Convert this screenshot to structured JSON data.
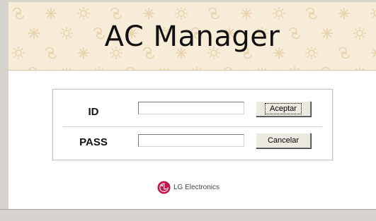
{
  "app": {
    "title": "AC Manager"
  },
  "login": {
    "id_label": "ID",
    "id_value": "",
    "pass_label": "PASS",
    "pass_value": "",
    "accept_label": "Aceptar",
    "cancel_label": "Cancelar"
  },
  "brand": {
    "text": "LG Electronics",
    "logo_icon": "lg-logo-icon"
  },
  "colors": {
    "banner_background": "#f6ecd8",
    "banner_pattern": "#e7d2ab",
    "logo_red": "#c4154c",
    "window_background": "#ffffff",
    "chrome_gray": "#d6d3ce"
  }
}
